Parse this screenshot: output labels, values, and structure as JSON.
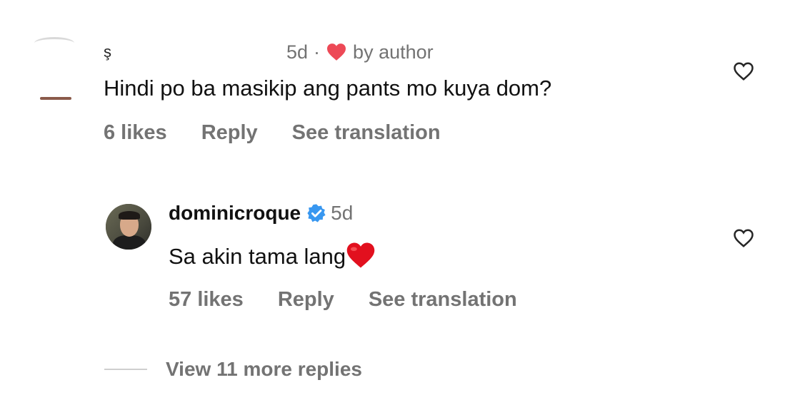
{
  "comment": {
    "username": "ş",
    "time": "5d",
    "separator": "·",
    "liked_by": "by author",
    "text": "Hindi po ba masikip ang pants mo kuya dom?",
    "likes": "6 likes",
    "reply_label": "Reply",
    "translate_label": "See translation"
  },
  "reply": {
    "username": "dominicroque",
    "time": "5d",
    "text": "Sa akin tama lang",
    "likes": "57 likes",
    "reply_label": "Reply",
    "translate_label": "See translation"
  },
  "view_more": "View 11 more replies",
  "colors": {
    "heart_red": "#ed4956",
    "verified_blue": "#3897f0",
    "muted_text": "#737373"
  },
  "icons": [
    "heart-outline-icon",
    "heart-filled-icon",
    "verified-badge-icon",
    "red-heart-emoji"
  ]
}
